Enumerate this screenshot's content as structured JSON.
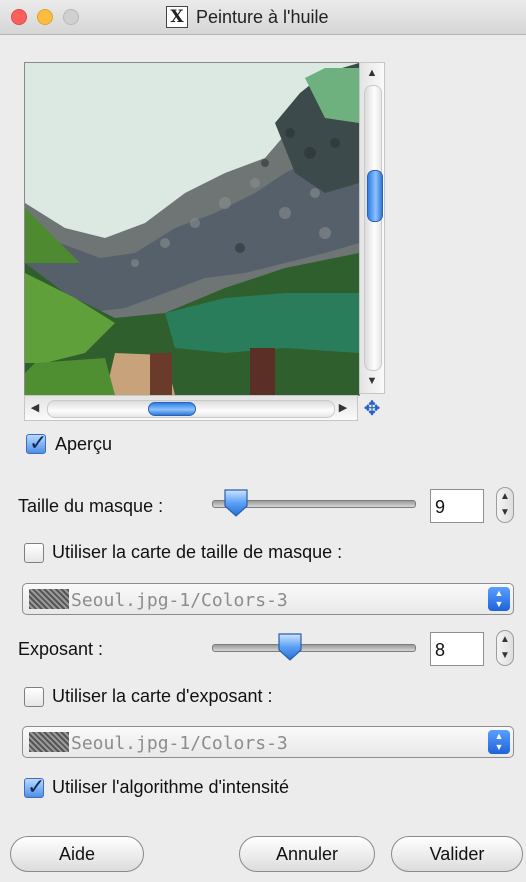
{
  "window": {
    "title": "Peinture à l'huile",
    "title_icon": "X"
  },
  "preview": {
    "checkbox_label": "Aperçu",
    "checkbox_mnemonic": "p",
    "checked": true
  },
  "mask_size": {
    "label": "Taille du masque :",
    "mnemonic": "T",
    "value": "9",
    "level": 0.06
  },
  "mask_map": {
    "label": "Utiliser la carte de taille de masque :",
    "checked": false,
    "combo_value": "Seoul.jpg-1/Colors-3"
  },
  "exponent": {
    "label": "Exposant :",
    "mnemonic": "E",
    "value": "8",
    "level": 0.37
  },
  "exponent_map": {
    "label": "Utiliser la carte d'exposant :",
    "mnemonic": "e",
    "checked": false,
    "combo_value": "Seoul.jpg-1/Colors-3"
  },
  "intensity": {
    "label": "Utiliser l'algorithme d'intensité",
    "mnemonic": "U",
    "checked": true
  },
  "buttons": {
    "help": "Aide",
    "cancel": "Annuler",
    "ok": "Valider"
  },
  "colors": {
    "accent": "#2d7fe8",
    "window_bg": "#ececec"
  }
}
